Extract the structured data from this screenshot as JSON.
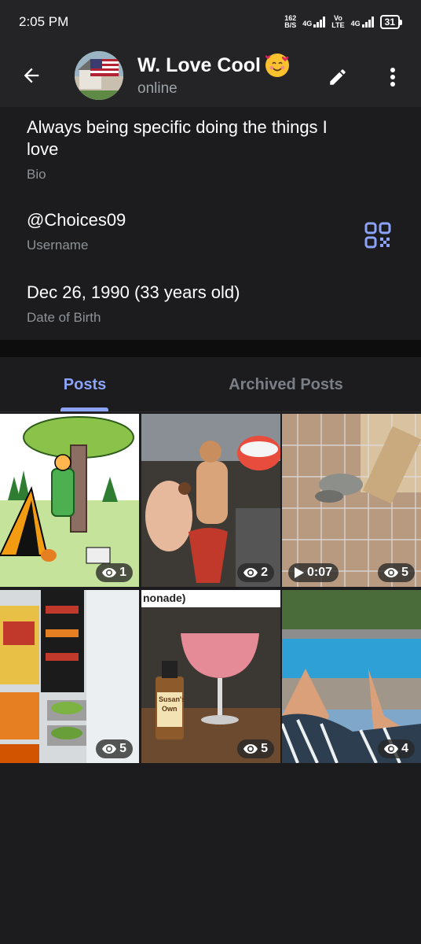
{
  "status_bar": {
    "time": "2:05 PM",
    "net_speed_value": "162",
    "net_speed_unit": "B/S",
    "sim1_tag": "4G",
    "volte_tag": "Vo",
    "volte_sub": "LTE",
    "sim2_tag": "4G",
    "battery": "31"
  },
  "header": {
    "name": "W. Love Cool",
    "status": "online",
    "icons": {
      "back": "arrow-left-icon",
      "edit": "pencil-icon",
      "more": "more-vertical-icon",
      "emoji": "smiling-face-with-hearts"
    }
  },
  "info": {
    "bio_value": "Always being specific doing the things I love",
    "bio_label": "Bio",
    "username_value": "@Choices09",
    "username_label": "Username",
    "dob_value": "Dec 26, 1990 (33 years old)",
    "dob_label": "Date of Birth",
    "qr_icon": "qr-code-icon",
    "accent": "#8ba4f9"
  },
  "tabs": {
    "posts": "Posts",
    "archived": "Archived Posts",
    "active": "Posts"
  },
  "posts": [
    {
      "views": "1",
      "desc": "cartoon"
    },
    {
      "views": "2",
      "desc": "mermaid ornament"
    },
    {
      "views": "5",
      "duration": "0:07",
      "desc": "snake enclosure video"
    },
    {
      "views": "5",
      "desc": "food display"
    },
    {
      "views": "5",
      "caption": "nonade)",
      "bottle_text_1": "Susan's",
      "bottle_text_2": "Own",
      "desc": "cocktail"
    },
    {
      "views": "4",
      "desc": "pool"
    }
  ]
}
